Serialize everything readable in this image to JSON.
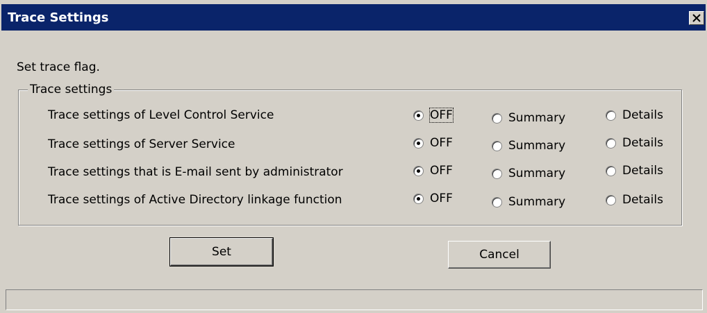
{
  "window": {
    "title": "Trace Settings"
  },
  "instruction": "Set trace flag.",
  "group": {
    "legend": "Trace settings",
    "options": [
      "OFF",
      "Summary",
      "Details"
    ],
    "rows": [
      {
        "label": "Trace settings of Level Control Service",
        "selected": "OFF"
      },
      {
        "label": "Trace settings of Server Service",
        "selected": "OFF"
      },
      {
        "label": "Trace settings that is E-mail sent by administrator",
        "selected": "OFF"
      },
      {
        "label": "Trace settings of Active Directory linkage function",
        "selected": "OFF"
      }
    ]
  },
  "buttons": {
    "set": "Set",
    "cancel": "Cancel"
  },
  "status": {
    "text": ""
  }
}
